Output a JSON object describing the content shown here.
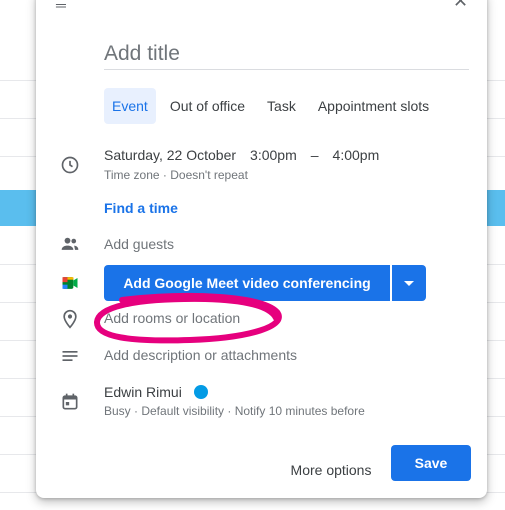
{
  "dialog": {
    "title_placeholder": "Add title",
    "tabs": [
      {
        "label": "Event",
        "active": true
      },
      {
        "label": "Out of office",
        "active": false
      },
      {
        "label": "Task",
        "active": false
      },
      {
        "label": "Appointment slots",
        "active": false
      }
    ],
    "datetime": {
      "date": "Saturday, 22 October",
      "start": "3:00pm",
      "dash": "–",
      "end": "4:00pm",
      "sub": "Time zone · Doesn't repeat"
    },
    "find_time": "Find a time",
    "guests_placeholder": "Add guests",
    "meet_button": "Add Google Meet video conferencing",
    "location_placeholder": "Add rooms or location",
    "description_placeholder": "Add description or attachments",
    "calendar": {
      "owner": "Edwin Rimui",
      "color": "#039be5",
      "details": "Busy · Default visibility · Notify 10 minutes before"
    },
    "footer": {
      "more_options": "More options",
      "save": "Save"
    }
  },
  "colors": {
    "accent": "#1a73e8",
    "calendar_event": "#039be5",
    "annotation": "#e6007e"
  },
  "icons": [
    "drag-handle-icon",
    "close-icon",
    "clock-icon",
    "guests-icon",
    "google-meet-icon",
    "chevron-down-icon",
    "location-pin-icon",
    "description-icon",
    "calendar-icon"
  ]
}
